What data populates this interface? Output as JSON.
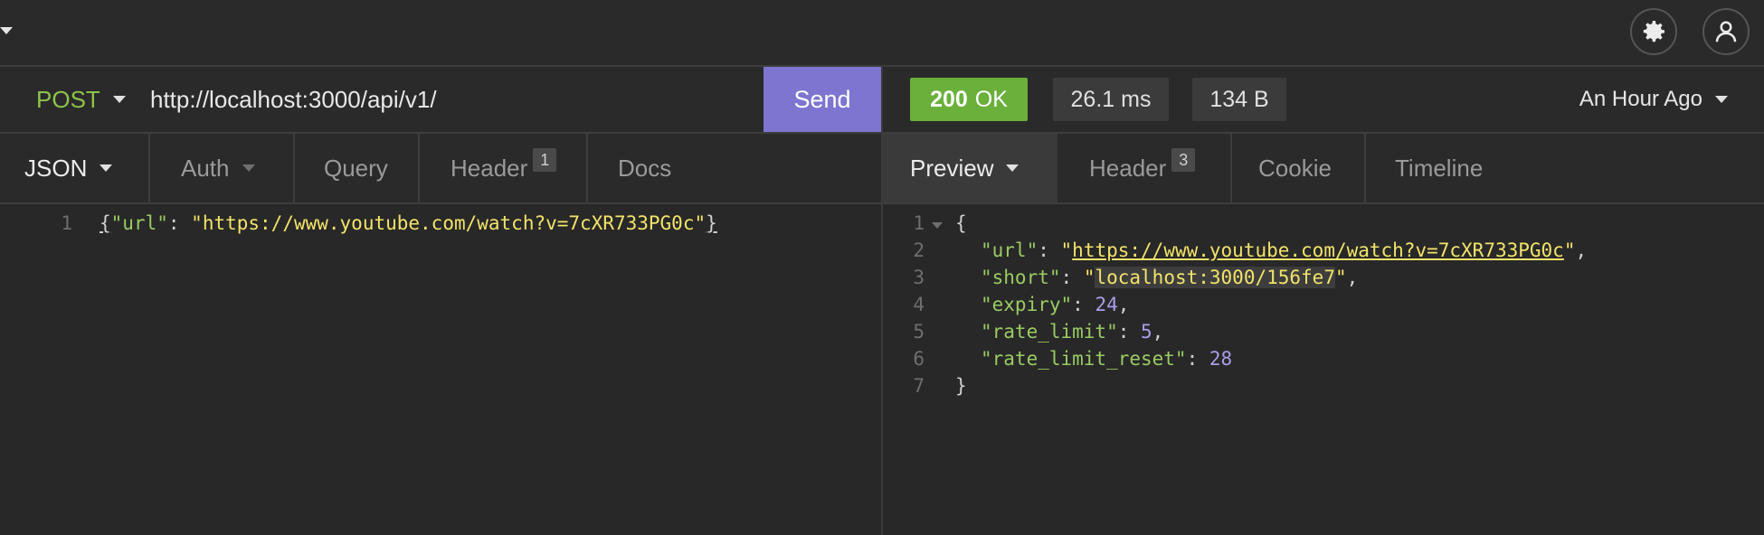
{
  "topbar": {
    "settings_icon": "gear-icon",
    "account_icon": "user-icon"
  },
  "request": {
    "method": "POST",
    "url": "http://localhost:3000/api/v1/",
    "send_label": "Send",
    "tabs": [
      {
        "label": "JSON"
      },
      {
        "label": "Auth"
      },
      {
        "label": "Query"
      },
      {
        "label": "Header",
        "badge": "1"
      },
      {
        "label": "Docs"
      }
    ],
    "body_lines": [
      "1"
    ],
    "body": {
      "open": "{",
      "key": "\"url\"",
      "colon": ": ",
      "value": "\"https://www.youtube.com/watch?v=7cXR733PG0c\"",
      "close": "}"
    }
  },
  "response": {
    "status_code": "200",
    "status_text": "OK",
    "time": "26.1 ms",
    "size": "134 B",
    "history": "An Hour Ago",
    "tabs": [
      {
        "label": "Preview"
      },
      {
        "label": "Header",
        "badge": "3"
      },
      {
        "label": "Cookie"
      },
      {
        "label": "Timeline"
      }
    ],
    "line_numbers": [
      "1",
      "2",
      "3",
      "4",
      "5",
      "6",
      "7"
    ],
    "lines": [
      {
        "text": "{"
      },
      {
        "key": "\"url\"",
        "open_q": "\"",
        "value": "https://www.youtube.com/watch?v=7cXR733PG0c",
        "close_q": "\"",
        "trail": ","
      },
      {
        "key": "\"short\"",
        "open_q": "\"",
        "value": "localhost:3000/156fe7",
        "close_q": "\"",
        "trail": ","
      },
      {
        "key": "\"expiry\"",
        "value": "24",
        "trail": ","
      },
      {
        "key": "\"rate_limit\"",
        "value": "5",
        "trail": ","
      },
      {
        "key": "\"rate_limit_reset\"",
        "value": "28",
        "trail": ""
      },
      {
        "text": "}"
      }
    ]
  },
  "colors": {
    "accent_send": "#7e75d1",
    "status_ok": "#6ab03b",
    "method_post": "#8dc34a",
    "json_key": "#9acb63",
    "json_string": "#f2e36a",
    "json_number": "#a99de8"
  }
}
